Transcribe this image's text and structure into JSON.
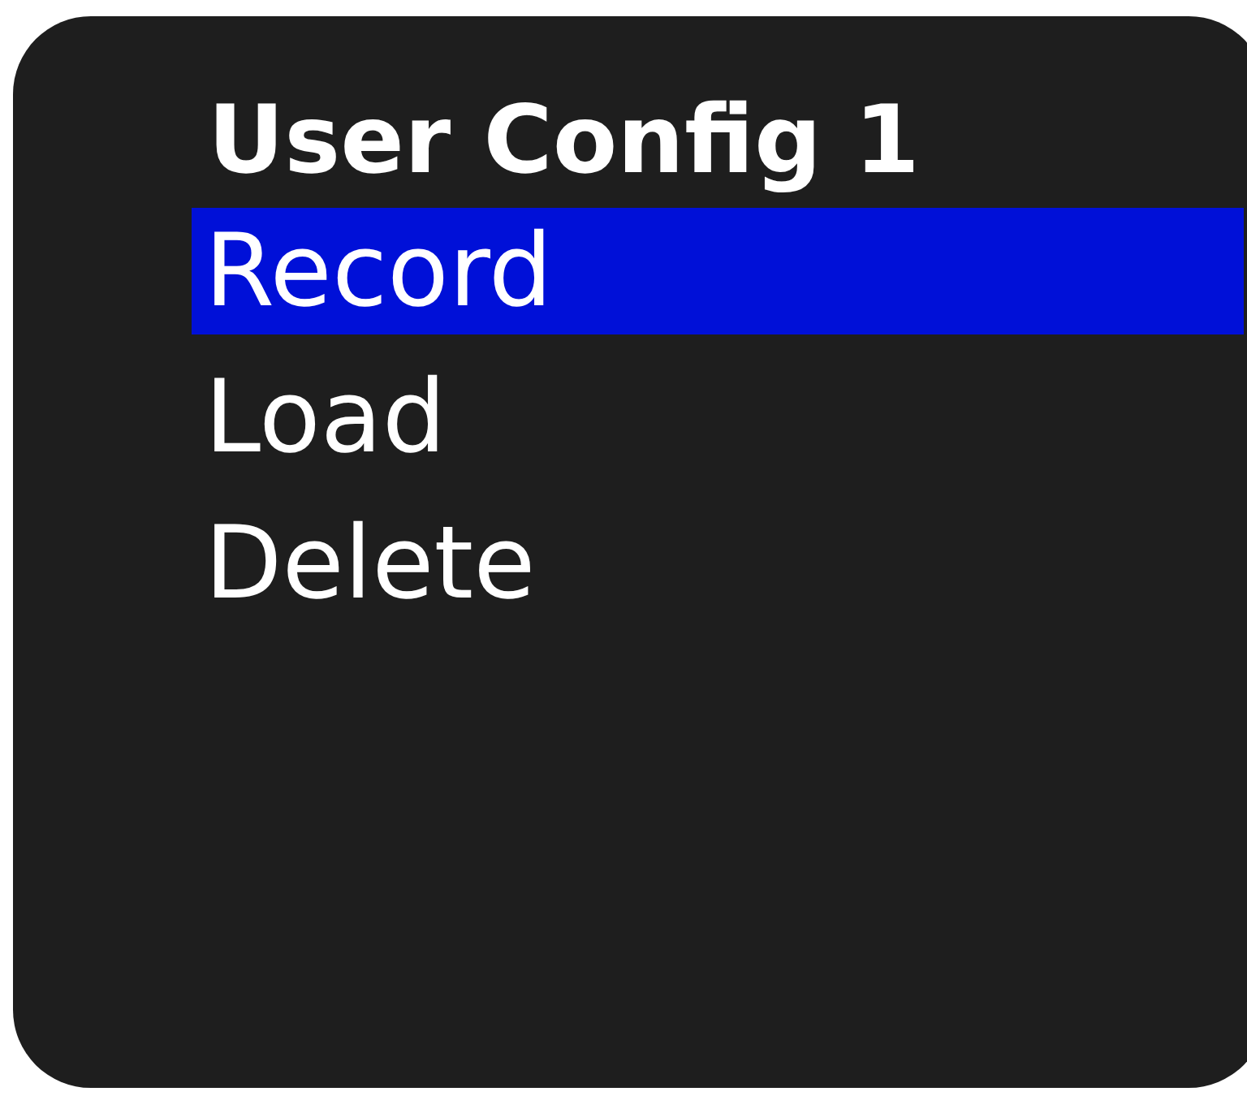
{
  "title": "User Config 1",
  "menu": [
    {
      "label": "Record",
      "selected": true
    },
    {
      "label": "Load",
      "selected": false
    },
    {
      "label": "Delete",
      "selected": false
    }
  ]
}
